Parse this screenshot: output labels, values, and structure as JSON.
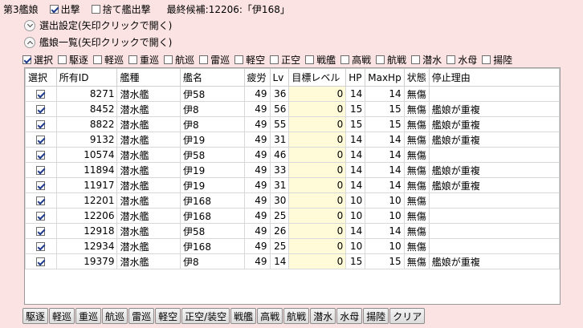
{
  "header": {
    "fleet_label": "第3艦娘",
    "sortie_label": "出撃",
    "sortie_checked": true,
    "discard_label": "捨て艦出撃",
    "discard_checked": false,
    "last_candidate": "最終候補:12206:「伊168」"
  },
  "sections": {
    "selection_settings": "選出設定(矢印クリックで開く)",
    "ship_list": "艦娘一覧(矢印クリックで開く)"
  },
  "filters": [
    {
      "label": "選択",
      "checked": true
    },
    {
      "label": "駆逐",
      "checked": false
    },
    {
      "label": "軽巡",
      "checked": false
    },
    {
      "label": "重巡",
      "checked": false
    },
    {
      "label": "航巡",
      "checked": false
    },
    {
      "label": "雷巡",
      "checked": false
    },
    {
      "label": "軽空",
      "checked": false
    },
    {
      "label": "正空",
      "checked": false
    },
    {
      "label": "戦艦",
      "checked": false
    },
    {
      "label": "高戦",
      "checked": false
    },
    {
      "label": "航戦",
      "checked": false
    },
    {
      "label": "潜水",
      "checked": false
    },
    {
      "label": "水母",
      "checked": false
    },
    {
      "label": "揚陸",
      "checked": false
    }
  ],
  "table": {
    "columns": [
      "選択",
      "所有ID",
      "艦種",
      "艦名",
      "疲労",
      "Lv",
      "目標レベル",
      "HP",
      "MaxHp",
      "状態",
      "停止理由"
    ],
    "rows": [
      {
        "selected": true,
        "id": "8271",
        "type": "潜水艦",
        "name": "伊58",
        "fatigue": "49",
        "lv": "36",
        "target": "0",
        "hp": "14",
        "maxhp": "14",
        "state": "無傷",
        "reason": ""
      },
      {
        "selected": true,
        "id": "8452",
        "type": "潜水艦",
        "name": "伊8",
        "fatigue": "49",
        "lv": "56",
        "target": "0",
        "hp": "15",
        "maxhp": "15",
        "state": "無傷",
        "reason": "艦娘が重複"
      },
      {
        "selected": true,
        "id": "8822",
        "type": "潜水艦",
        "name": "伊8",
        "fatigue": "49",
        "lv": "55",
        "target": "0",
        "hp": "15",
        "maxhp": "15",
        "state": "無傷",
        "reason": "艦娘が重複"
      },
      {
        "selected": true,
        "id": "9132",
        "type": "潜水艦",
        "name": "伊19",
        "fatigue": "49",
        "lv": "31",
        "target": "0",
        "hp": "14",
        "maxhp": "14",
        "state": "無傷",
        "reason": "艦娘が重複"
      },
      {
        "selected": true,
        "id": "10574",
        "type": "潜水艦",
        "name": "伊58",
        "fatigue": "49",
        "lv": "46",
        "target": "0",
        "hp": "14",
        "maxhp": "14",
        "state": "無傷",
        "reason": ""
      },
      {
        "selected": true,
        "id": "11894",
        "type": "潜水艦",
        "name": "伊19",
        "fatigue": "49",
        "lv": "33",
        "target": "0",
        "hp": "14",
        "maxhp": "14",
        "state": "無傷",
        "reason": "艦娘が重複"
      },
      {
        "selected": true,
        "id": "11917",
        "type": "潜水艦",
        "name": "伊19",
        "fatigue": "49",
        "lv": "31",
        "target": "0",
        "hp": "14",
        "maxhp": "14",
        "state": "無傷",
        "reason": "艦娘が重複"
      },
      {
        "selected": true,
        "id": "12201",
        "type": "潜水艦",
        "name": "伊168",
        "fatigue": "49",
        "lv": "30",
        "target": "0",
        "hp": "10",
        "maxhp": "10",
        "state": "無傷",
        "reason": ""
      },
      {
        "selected": true,
        "id": "12206",
        "type": "潜水艦",
        "name": "伊168",
        "fatigue": "49",
        "lv": "25",
        "target": "0",
        "hp": "10",
        "maxhp": "10",
        "state": "無傷",
        "reason": ""
      },
      {
        "selected": true,
        "id": "12918",
        "type": "潜水艦",
        "name": "伊58",
        "fatigue": "49",
        "lv": "26",
        "target": "0",
        "hp": "14",
        "maxhp": "14",
        "state": "無傷",
        "reason": ""
      },
      {
        "selected": true,
        "id": "12934",
        "type": "潜水艦",
        "name": "伊168",
        "fatigue": "49",
        "lv": "25",
        "target": "0",
        "hp": "10",
        "maxhp": "10",
        "state": "無傷",
        "reason": ""
      },
      {
        "selected": true,
        "id": "19379",
        "type": "潜水艦",
        "name": "伊8",
        "fatigue": "49",
        "lv": "14",
        "target": "0",
        "hp": "15",
        "maxhp": "15",
        "state": "無傷",
        "reason": "艦娘が重複"
      }
    ]
  },
  "buttons": [
    "駆逐",
    "軽巡",
    "重巡",
    "航巡",
    "雷巡",
    "軽空",
    "正空/装空",
    "戦艦",
    "高戦",
    "航戦",
    "潜水",
    "水母",
    "揚陸",
    "クリア"
  ],
  "colors": {
    "background": "#fbe3e3",
    "target_cell": "#fffbd9"
  }
}
